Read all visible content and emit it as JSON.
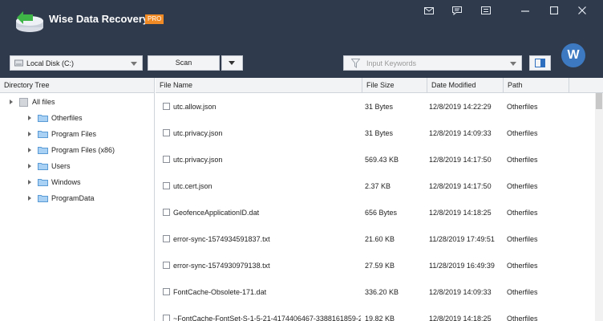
{
  "app": {
    "title": "Wise Data Recovery",
    "badge": "PRO"
  },
  "window_controls": [
    "mail-icon",
    "feedback-icon",
    "menu-icon",
    "minimize-icon",
    "maximize-icon",
    "close-icon"
  ],
  "toolbar": {
    "drive": "Local Disk (C:)",
    "scan_label": "Scan",
    "search_placeholder": "Input Keywords"
  },
  "user": {
    "avatar_letter": "W"
  },
  "tree": {
    "header": "Directory Tree",
    "root": "All files",
    "items": [
      "Otherfiles",
      "Program Files",
      "Program Files (x86)",
      "Users",
      "Windows",
      "ProgramData"
    ]
  },
  "list": {
    "columns": [
      "File Name",
      "File Size",
      "Date Modified",
      "Path"
    ],
    "rows": [
      {
        "name": "utc.allow.json",
        "size": "31 Bytes",
        "date": "12/8/2019 14:22:29",
        "path": "Otherfiles"
      },
      {
        "name": "utc.privacy.json",
        "size": "31 Bytes",
        "date": "12/8/2019 14:09:33",
        "path": "Otherfiles"
      },
      {
        "name": "utc.privacy.json",
        "size": "569.43 KB",
        "date": "12/8/2019 14:17:50",
        "path": "Otherfiles"
      },
      {
        "name": "utc.cert.json",
        "size": "2.37 KB",
        "date": "12/8/2019 14:17:50",
        "path": "Otherfiles"
      },
      {
        "name": "GeofenceApplicationID.dat",
        "size": "656 Bytes",
        "date": "12/8/2019 14:18:25",
        "path": "Otherfiles"
      },
      {
        "name": "error-sync-1574934591837.txt",
        "size": "21.60 KB",
        "date": "11/28/2019 17:49:51",
        "path": "Otherfiles"
      },
      {
        "name": "error-sync-1574930979138.txt",
        "size": "27.59 KB",
        "date": "11/28/2019 16:49:39",
        "path": "Otherfiles"
      },
      {
        "name": "FontCache-Obsolete-171.dat",
        "size": "336.20 KB",
        "date": "12/8/2019 14:09:33",
        "path": "Otherfiles"
      },
      {
        "name": "~FontCache-FontSet-S-1-5-21-4174406467-3388161859-22",
        "size": "19.82 KB",
        "date": "12/8/2019 14:18:25",
        "path": "Otherfiles"
      }
    ]
  },
  "colors": {
    "titlebar": "#2f3a4c",
    "accent": "#f08a24",
    "folder": "#7fb7e8"
  }
}
